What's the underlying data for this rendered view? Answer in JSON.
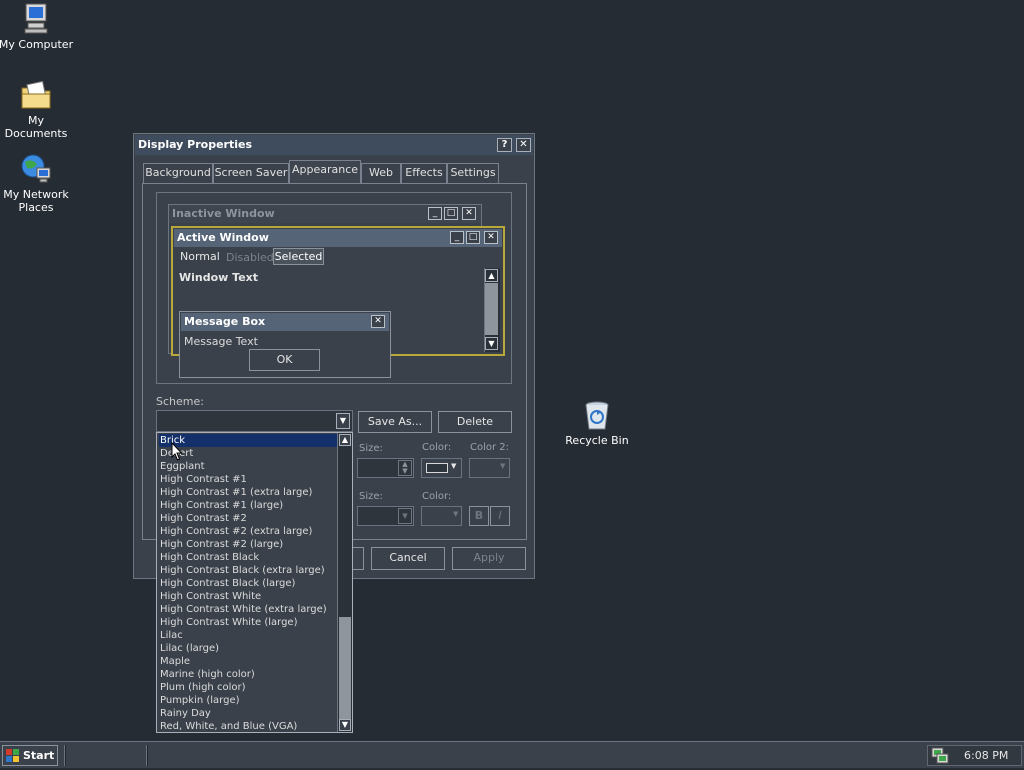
{
  "desktop": {
    "icons": [
      {
        "label": "My Computer"
      },
      {
        "label": "My Documents"
      },
      {
        "label": "My Network Places"
      },
      {
        "label": "Recycle Bin"
      }
    ]
  },
  "window": {
    "title": "Display Properties",
    "help_btn": "?",
    "close_btn": "✕"
  },
  "tabs": [
    {
      "label": "Background"
    },
    {
      "label": "Screen Saver"
    },
    {
      "label": "Appearance"
    },
    {
      "label": "Web"
    },
    {
      "label": "Effects"
    },
    {
      "label": "Settings"
    }
  ],
  "preview": {
    "inactive_title": "Inactive Window",
    "active_title": "Active Window",
    "menu_normal": "Normal",
    "menu_disabled": "Disabled",
    "menu_selected": "Selected",
    "window_text": "Window Text",
    "msgbox_title": "Message Box",
    "msgbox_text": "Message Text",
    "ok": "OK"
  },
  "scheme": {
    "label": "Scheme:",
    "save_as": "Save As...",
    "delete": "Delete",
    "size_label": "Size:",
    "color_label": "Color:",
    "color2_label": "Color 2:",
    "size2_label": "Size:",
    "color3_label": "Color:",
    "bold": "B",
    "italic": "I",
    "options": [
      "Brick",
      "Desert",
      "Eggplant",
      "High Contrast #1",
      "High Contrast #1 (extra large)",
      "High Contrast #1 (large)",
      "High Contrast #2",
      "High Contrast #2 (extra large)",
      "High Contrast #2 (large)",
      "High Contrast Black",
      "High Contrast Black (extra large)",
      "High Contrast Black (large)",
      "High Contrast White",
      "High Contrast White (extra large)",
      "High Contrast White (large)",
      "Lilac",
      "Lilac (large)",
      "Maple",
      "Marine (high color)",
      "Plum (high color)",
      "Pumpkin (large)",
      "Rainy Day",
      "Red, White, and Blue (VGA)"
    ],
    "selected_index": 0
  },
  "footer": {
    "cancel": "Cancel",
    "apply": "Apply"
  },
  "taskbar": {
    "start": "Start",
    "clock": "6:08 PM"
  }
}
